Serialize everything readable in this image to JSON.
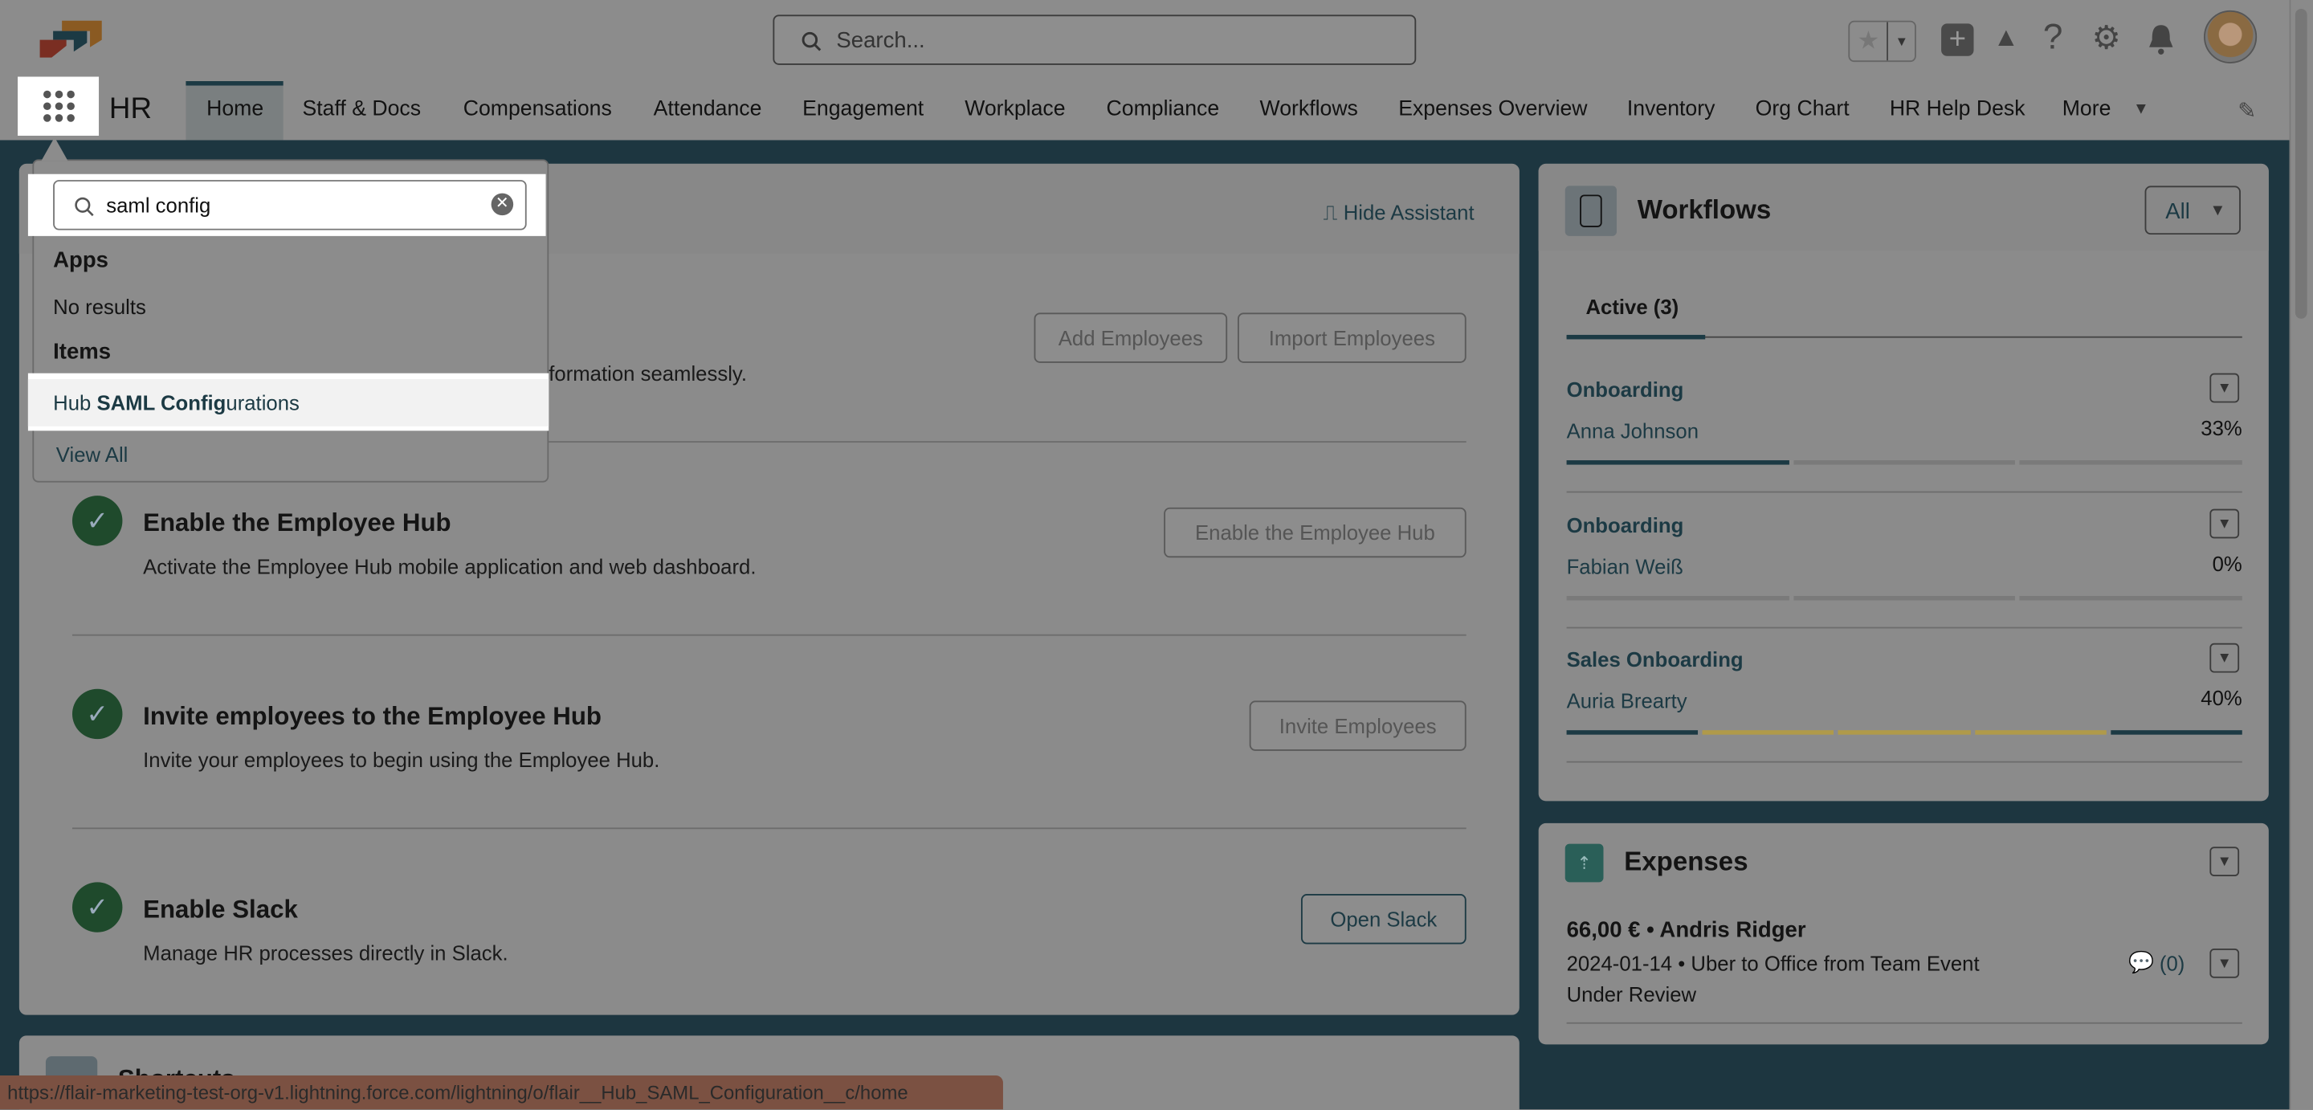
{
  "header": {
    "search_placeholder": "Search...",
    "app_name": "HR"
  },
  "nav": {
    "tabs": [
      "Home",
      "Staff & Docs",
      "Compensations",
      "Attendance",
      "Engagement",
      "Workplace",
      "Compliance",
      "Workflows",
      "Expenses Overview",
      "Inventory",
      "Org Chart",
      "HR Help Desk",
      "More"
    ],
    "active": "Home"
  },
  "launcher_dropdown": {
    "search_value": "saml config",
    "apps_heading": "Apps",
    "apps_empty": "No results",
    "items_heading": "Items",
    "item_prefix": "Hub ",
    "item_match": "SAML Config",
    "item_suffix": "urations",
    "view_all": "View All"
  },
  "assistant": {
    "hide_label": "Hide Assistant",
    "intro_tail": "formation seamlessly.",
    "add_employees": "Add Employees",
    "import_employees": "Import Employees",
    "steps": [
      {
        "title": "Enable the Employee Hub",
        "desc": "Activate the Employee Hub mobile application and web dashboard.",
        "button": "Enable the Employee Hub"
      },
      {
        "title": "Invite employees to the Employee Hub",
        "desc": "Invite your employees to begin using the Employee Hub.",
        "button": "Invite Employees"
      },
      {
        "title": "Enable Slack",
        "desc": "Manage HR processes directly in Slack.",
        "button": "Open Slack"
      }
    ]
  },
  "shortcuts": {
    "title": "Shortcuts"
  },
  "workflows": {
    "title": "Workflows",
    "filter": "All",
    "tab": "Active (3)",
    "items": [
      {
        "name": "Onboarding",
        "person": "Anna Johnson",
        "percent": "33%",
        "progress": 0.33
      },
      {
        "name": "Onboarding",
        "person": "Fabian Weiß",
        "percent": "0%",
        "progress": 0
      },
      {
        "name": "Sales Onboarding",
        "person": "Auria Brearty",
        "percent": "40%",
        "progress": 0.4
      }
    ]
  },
  "expenses": {
    "title": "Expenses",
    "amount_line": "66,00 € • Andris Ridger",
    "detail": "2024-01-14 • Uber to Office from Team Event",
    "status": "Under Review",
    "comments": "(0)"
  },
  "status_bar": {
    "url": "https://flair-marketing-test-org-v1.lightning.force.com/lightning/o/flair__Hub_SAML_Configuration__c/home"
  },
  "colors": {
    "brand": "#1c3a44",
    "teal_bg": "#1d3640",
    "highlight": "#ffffff",
    "progress_yellow": "#b09a4a"
  }
}
